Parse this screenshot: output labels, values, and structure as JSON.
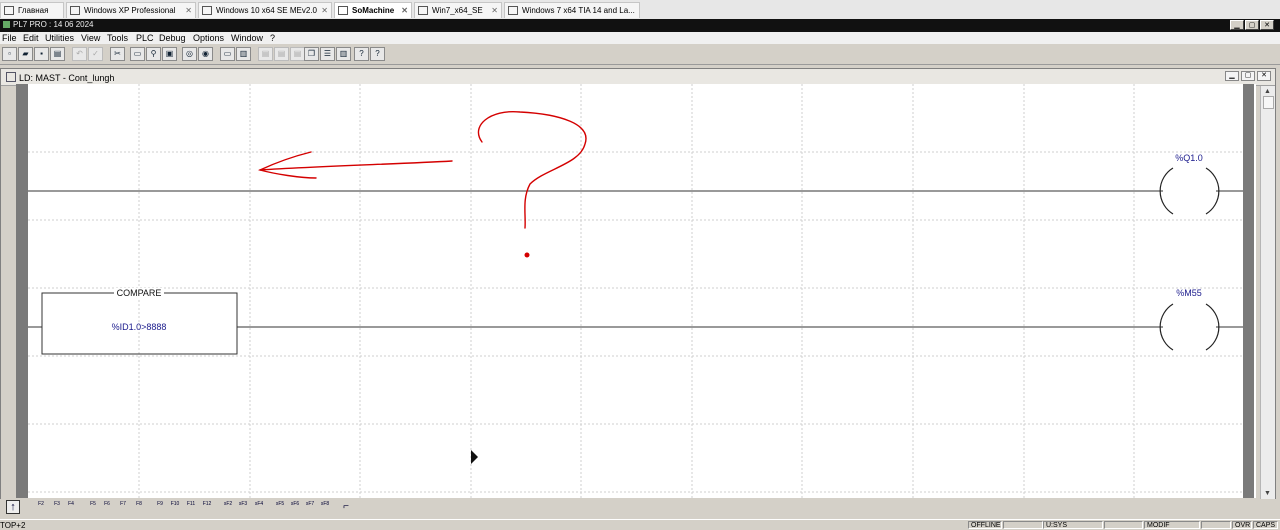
{
  "tabs": [
    {
      "label": "Главная",
      "active": false
    },
    {
      "label": "Windows XP Professional",
      "active": false
    },
    {
      "label": "Windows 10 x64 SE MEv2.0",
      "active": false
    },
    {
      "label": "SoMachine",
      "active": true
    },
    {
      "label": "Win7_x64_SE",
      "active": false
    },
    {
      "label": "Windows 7 x64 TIA 14 and La...",
      "active": false
    }
  ],
  "app": {
    "title": "PL7 PRO : 14 06 2024"
  },
  "menu": [
    "File",
    "Edit",
    "Utilities",
    "View",
    "Tools",
    "PLC",
    "Debug",
    "Options",
    "Window",
    "?"
  ],
  "editor": {
    "title": "LD: MAST - Cont_lungh",
    "rung1": {
      "coil_label": "%Q1.0"
    },
    "rung2": {
      "block_title": "COMPARE",
      "block_expr": "%ID1.0>8888",
      "coil_label": "%M55"
    }
  },
  "palette": [
    "F2",
    "F3",
    "F4",
    "F5",
    "F6",
    "F7",
    "F8",
    "F9",
    "F10",
    "F11",
    "F12",
    "sF2",
    "sF3",
    "sF4",
    "sF5",
    "sF6",
    "sF7",
    "sF8"
  ],
  "status": {
    "left": "TOP+2",
    "offline": "OFFLINE",
    "sys": "U:SYS",
    "modif": "MODIF",
    "ovr": "OVR",
    "caps": "CAPS"
  },
  "colors": {
    "label_blue": "#1a1a8c",
    "annotation_red": "#d40000",
    "rail_grey": "#7a7a7a"
  }
}
